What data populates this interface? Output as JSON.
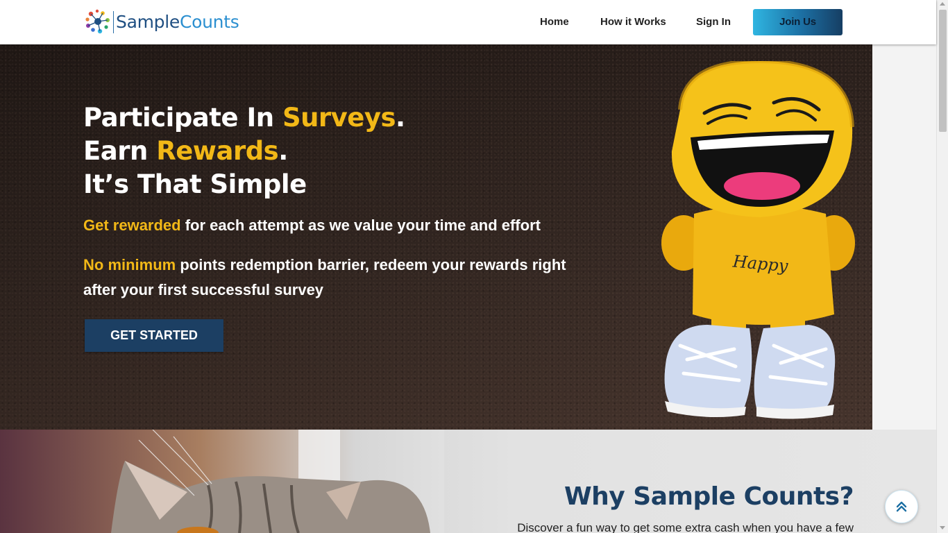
{
  "header": {
    "brand": {
      "part1": "Sample",
      "part2": "Counts"
    },
    "nav": [
      {
        "label": "Home"
      },
      {
        "label": "How it Works"
      },
      {
        "label": "Sign In"
      }
    ],
    "cta_label": "Join Us"
  },
  "hero": {
    "headline": {
      "line1_pre": "Participate In ",
      "line1_accent": "Surveys",
      "line1_post": ".",
      "line2_pre": "Earn ",
      "line2_accent": "Rewards",
      "line2_post": ".",
      "line3": "It’s That Simple"
    },
    "point1": {
      "accent": "Get rewarded",
      "rest": " for each attempt as we value your time and effort"
    },
    "point2": {
      "accent": "No minimum",
      "rest": " points redemption barrier, redeem your rewards right after your first successful survey"
    },
    "button_label": "GET STARTED",
    "figure_text": "Happy"
  },
  "why": {
    "title": "Why Sample Counts?",
    "text": "Discover a fun way to get some extra cash when you have a few"
  },
  "icons": {
    "logo": "logo-molecule-icon",
    "back_to_top": "double-chevron-up-icon"
  },
  "colors": {
    "accent": "#f2b817",
    "navy": "#1c3f63",
    "brand_dark": "#1f4f82",
    "brand_light": "#2b8fd0"
  }
}
